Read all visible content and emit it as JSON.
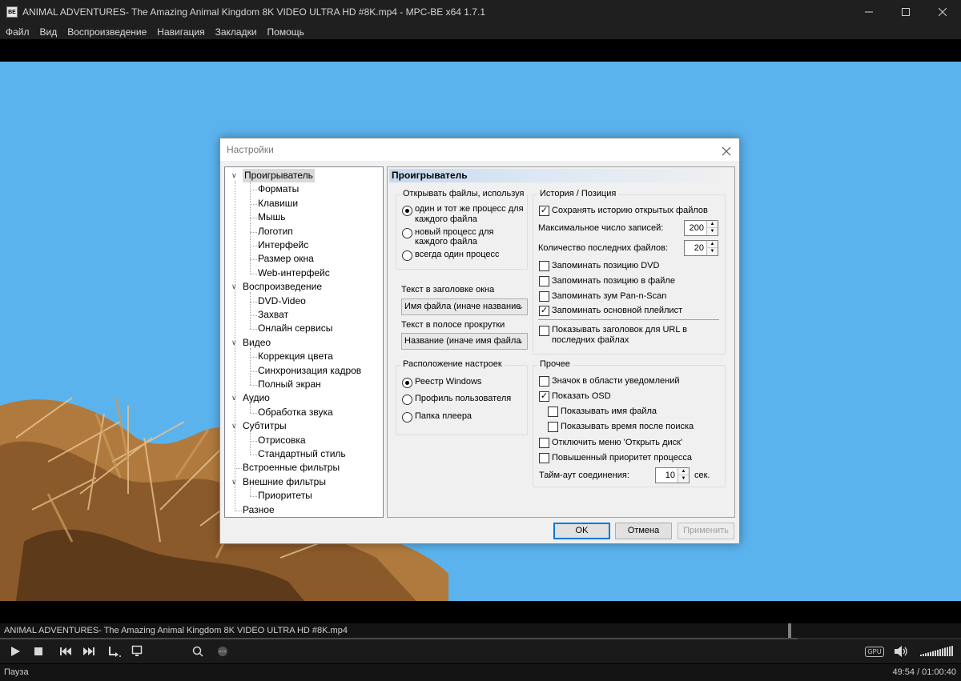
{
  "window": {
    "title": "ANIMAL ADVENTURES- The Amazing Animal Kingdom 8K VIDEO ULTRA HD #8K.mp4 - MPC-BE x64 1.7.1",
    "icon_text": "BE",
    "controls": [
      "minimize",
      "maximize",
      "close"
    ]
  },
  "menu": [
    "Файл",
    "Вид",
    "Воспроизведение",
    "Навигация",
    "Закладки",
    "Помощь"
  ],
  "player": {
    "file_info": "ANIMAL ADVENTURES- The Amazing Animal Kingdom 8K VIDEO ULTRA HD #8K.mp4",
    "seek_position_fraction": 0.83,
    "status": "Пауза",
    "time": "49:54 / 01:00:40",
    "gpu_badge": "GPU",
    "volume_fraction": 1.0
  },
  "dialog": {
    "title": "Настройки",
    "tree": [
      {
        "label": "Проигрыватель",
        "level": 0,
        "selected": true
      },
      {
        "label": "Форматы",
        "level": 1
      },
      {
        "label": "Клавиши",
        "level": 1
      },
      {
        "label": "Мышь",
        "level": 1
      },
      {
        "label": "Логотип",
        "level": 1
      },
      {
        "label": "Интерфейс",
        "level": 1
      },
      {
        "label": "Размер окна",
        "level": 1
      },
      {
        "label": "Web-интерфейс",
        "level": 1
      },
      {
        "label": "Воспроизведение",
        "level": 0
      },
      {
        "label": "DVD-Video",
        "level": 1
      },
      {
        "label": "Захват",
        "level": 1
      },
      {
        "label": "Онлайн сервисы",
        "level": 1
      },
      {
        "label": "Видео",
        "level": 0
      },
      {
        "label": "Коррекция цвета",
        "level": 1
      },
      {
        "label": "Синхронизация кадров",
        "level": 1
      },
      {
        "label": "Полный экран",
        "level": 1
      },
      {
        "label": "Аудио",
        "level": 0
      },
      {
        "label": "Обработка звука",
        "level": 1
      },
      {
        "label": "Субтитры",
        "level": 0
      },
      {
        "label": "Отрисовка",
        "level": 1
      },
      {
        "label": "Стандартный стиль",
        "level": 1
      },
      {
        "label": "Встроенные фильтры",
        "level": 0
      },
      {
        "label": "Внешние фильтры",
        "level": 0
      },
      {
        "label": "Приоритеты",
        "level": 1
      },
      {
        "label": "Разное",
        "level": 0
      }
    ],
    "panel_title": "Проигрыватель",
    "open_files": {
      "label": "Открывать файлы, используя",
      "options": [
        {
          "line1": "один и тот же процесс для",
          "line2": "каждого файла",
          "checked": true
        },
        {
          "line1": "новый процесс для",
          "line2": "каждого файла",
          "checked": false
        },
        {
          "line1": "всегда один процесс",
          "line2": "",
          "checked": false
        }
      ]
    },
    "window_title_text": {
      "label": "Текст в заголовке окна",
      "value": "Имя файла (иначе название"
    },
    "seekbar_text": {
      "label": "Текст в полосе прокрутки",
      "value": "Название (иначе имя файла"
    },
    "settings_location": {
      "label": "Расположение настроек",
      "options": [
        {
          "label": "Реестр Windows",
          "checked": true
        },
        {
          "label": "Профиль пользователя",
          "checked": false
        },
        {
          "label": "Папка плеера",
          "checked": false
        }
      ]
    },
    "history": {
      "label": "История / Позиция",
      "save_history": {
        "label": "Сохранять историю открытых файлов",
        "checked": true
      },
      "max_records": {
        "label": "Максимальное число записей:",
        "value": "200"
      },
      "recent_count": {
        "label": "Количество последних файлов:",
        "value": "20"
      },
      "remember_dvd": {
        "label": "Запоминать позицию DVD",
        "checked": false
      },
      "remember_file": {
        "label": "Запоминать позицию в файле",
        "checked": false
      },
      "remember_zoom": {
        "label": "Запоминать зум Pan-n-Scan",
        "checked": false
      },
      "remember_playlist": {
        "label": "Запоминать основной плейлист",
        "checked": true
      },
      "show_url_title": {
        "line1": "Показывать заголовок для URL в",
        "line2": "последних файлах",
        "checked": false
      }
    },
    "other": {
      "label": "Прочее",
      "tray_icon": {
        "label": "Значок в области уведомлений",
        "checked": false
      },
      "show_osd": {
        "label": "Показать OSD",
        "checked": true
      },
      "show_filename": {
        "label": "Показывать имя файла",
        "checked": false
      },
      "show_time_after_seek": {
        "label": "Показывать время после поиска",
        "checked": false
      },
      "disable_open_disc": {
        "label": "Отключить меню 'Открыть диск'",
        "checked": false
      },
      "high_priority": {
        "label": "Повышенный приоритет процесса",
        "checked": false
      },
      "timeout": {
        "label": "Тайм-аут соединения:",
        "value": "10",
        "unit": "сек."
      }
    },
    "buttons": {
      "ok": "OK",
      "cancel": "Отмена",
      "apply": "Применить"
    }
  }
}
